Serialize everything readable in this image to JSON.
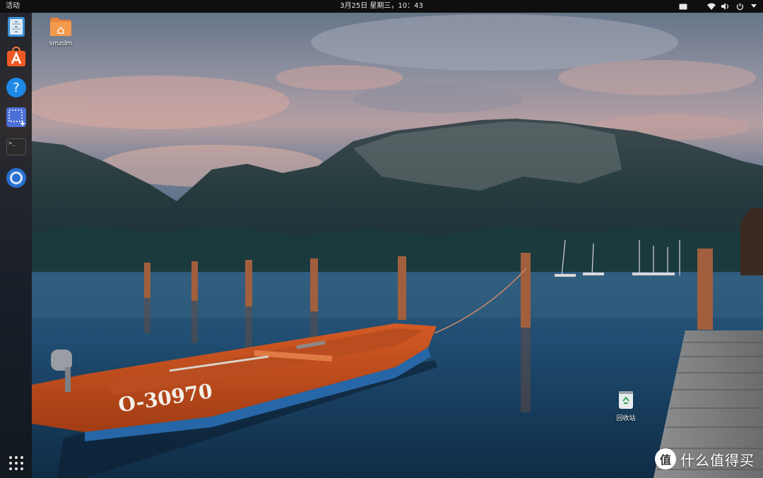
{
  "topbar": {
    "activities_label": "活动",
    "clock": "3月25日 星期三，10：43",
    "tray_icons": [
      "display-icon",
      "network-icon",
      "volume-icon",
      "power-icon",
      "chevron-down-icon"
    ]
  },
  "dock": {
    "items": [
      {
        "name": "files",
        "icon": "file-cabinet-icon"
      },
      {
        "name": "software-center",
        "icon": "shopping-bag-icon"
      },
      {
        "name": "help",
        "icon": "question-icon"
      },
      {
        "name": "screenshot",
        "icon": "screenshot-icon"
      },
      {
        "name": "terminal",
        "icon": "terminal-icon",
        "glyph": ">_"
      },
      {
        "name": "chromium",
        "icon": "browser-icon"
      }
    ],
    "show_apps_icon": "grid-icon"
  },
  "desktop": {
    "home_folder_label": "smzdm",
    "trash_label": "回收站",
    "boat_number": "O-30970"
  },
  "watermark": {
    "logo_glyph": "值",
    "text": "什么值得买"
  },
  "colors": {
    "topbar": "#0f0f0f",
    "dock": "#141416",
    "folder": "#e8843a",
    "boat": "#c9501e"
  }
}
